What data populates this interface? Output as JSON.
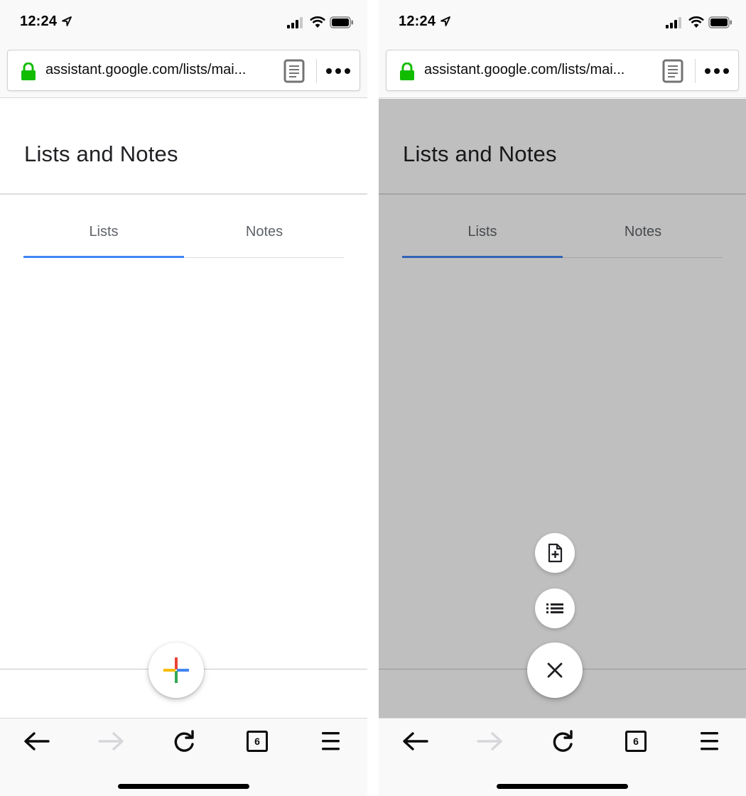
{
  "status": {
    "time": "12:24"
  },
  "browser": {
    "url": "assistant.google.com/lists/mai..."
  },
  "page": {
    "title": "Lists and Notes",
    "tabs": [
      {
        "label": "Lists",
        "active": true
      },
      {
        "label": "Notes",
        "active": false
      }
    ]
  },
  "toolbar": {
    "tab_count": "6"
  },
  "icons": {
    "location": "location-arrow-icon",
    "signal": "cellular-signal-icon",
    "wifi": "wifi-icon",
    "battery": "battery-icon",
    "lock": "lock-icon",
    "reader": "reader-view-icon",
    "more": "more-options-icon",
    "fab": "add-icon",
    "new_note": "new-note-icon",
    "new_list": "new-list-icon",
    "close": "close-icon",
    "back": "back-arrow-icon",
    "forward": "forward-arrow-icon",
    "reload": "reload-icon",
    "tabs": "tabs-icon",
    "menu": "menu-icon"
  },
  "colors": {
    "accent": "#4285f4",
    "lock": "#12bc00",
    "google_red": "#ea4335",
    "google_blue": "#4285f4",
    "google_yellow": "#fbbc05",
    "google_green": "#34a853"
  }
}
